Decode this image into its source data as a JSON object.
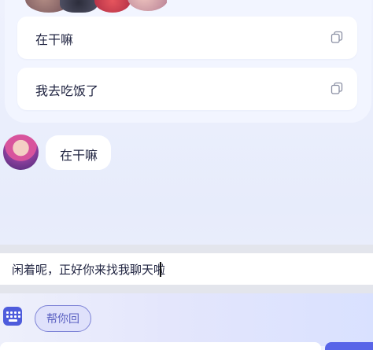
{
  "suggestions": [
    {
      "text": "在干嘛"
    },
    {
      "text": "我去吃饭了"
    }
  ],
  "chat": {
    "message": "在干嘛"
  },
  "composer": {
    "value": "闲着呢，正好你来找我聊天啦"
  },
  "toolbar": {
    "help_label": "帮你回"
  },
  "colors": {
    "accent": "#4e5cdc",
    "chip_text": "#5b61c2"
  },
  "icons": [
    "copy-icon",
    "keyboard-icon"
  ]
}
